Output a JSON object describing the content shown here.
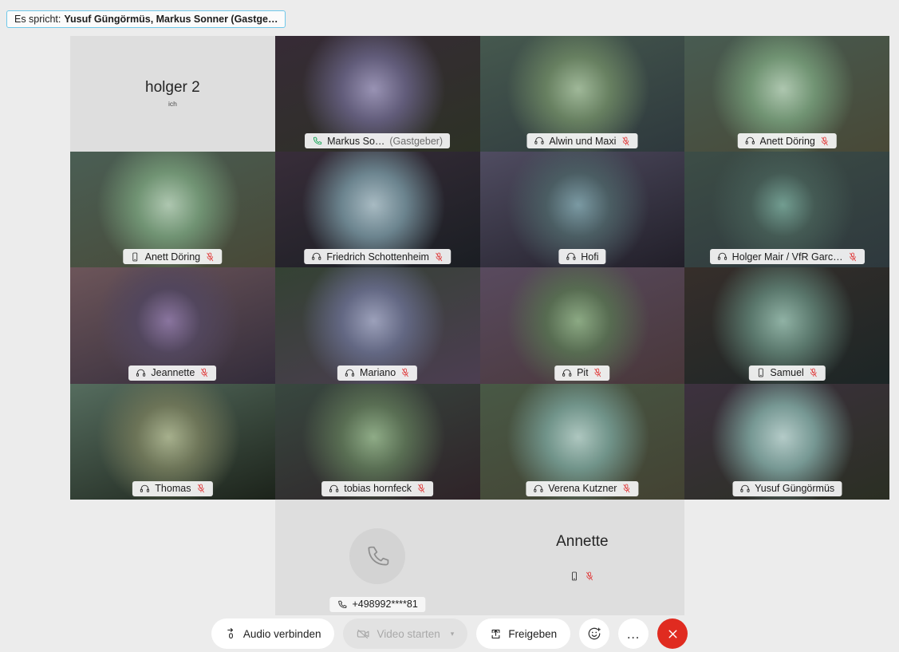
{
  "app": {
    "background_color": "#ececec",
    "active_speaker_color": "#42bdf0",
    "mute_color": "#e03a3a",
    "leave_color": "#e02b20"
  },
  "speaker_banner": {
    "name": "speaker-banner",
    "prefix": "Es spricht:",
    "names": "Yusuf Güngörmüs, Markus Sonner (Gastge…"
  },
  "grid": {
    "columns": 4,
    "rows": 5,
    "tiles": [
      {
        "id": "holger-2",
        "kind": "placeholder",
        "name": "holger 2",
        "sub": "ich",
        "icons": [],
        "active": false,
        "badge": false
      },
      {
        "id": "markus-sonner",
        "kind": "video",
        "name": "Markus So…",
        "host_suffix": "(Gastgeber)",
        "icons": [
          "phone-green"
        ],
        "muted": false,
        "active": true,
        "badge": true
      },
      {
        "id": "alwin-und-maxi",
        "kind": "video",
        "name": "Alwin und Maxi",
        "icons": [
          "headset"
        ],
        "muted": true,
        "active": false,
        "badge": true
      },
      {
        "id": "anett-doring-1",
        "kind": "video",
        "name": "Anett Döring",
        "icons": [
          "headset"
        ],
        "muted": true,
        "active": false,
        "badge": true
      },
      {
        "id": "anett-doring-2",
        "kind": "video",
        "name": "Anett Döring",
        "icons": [
          "mobile"
        ],
        "muted": true,
        "active": false,
        "badge": true
      },
      {
        "id": "friedrich-schottenheim",
        "kind": "video",
        "name": "Friedrich Schottenheim",
        "icons": [
          "headset"
        ],
        "muted": true,
        "active": false,
        "badge": true
      },
      {
        "id": "hofi",
        "kind": "video",
        "name": "Hofi",
        "icons": [
          "headset"
        ],
        "muted": false,
        "active": false,
        "badge": true
      },
      {
        "id": "holger-mair",
        "kind": "video",
        "name": "Holger Mair / VfR Garc…",
        "icons": [
          "headset"
        ],
        "muted": true,
        "active": false,
        "badge": true
      },
      {
        "id": "jeannette",
        "kind": "video",
        "name": "Jeannette",
        "icons": [
          "headset"
        ],
        "muted": true,
        "active": false,
        "badge": true
      },
      {
        "id": "mariano",
        "kind": "video",
        "name": "Mariano",
        "icons": [
          "headset"
        ],
        "muted": true,
        "active": false,
        "badge": true
      },
      {
        "id": "pit",
        "kind": "video",
        "name": "Pit",
        "icons": [
          "headset"
        ],
        "muted": true,
        "active": false,
        "badge": true
      },
      {
        "id": "samuel",
        "kind": "video",
        "name": "Samuel",
        "icons": [
          "mobile"
        ],
        "muted": true,
        "active": false,
        "badge": true
      },
      {
        "id": "thomas",
        "kind": "video",
        "name": "Thomas",
        "icons": [
          "headset"
        ],
        "muted": true,
        "active": false,
        "badge": true
      },
      {
        "id": "tobias-hornfeck",
        "kind": "video",
        "name": "tobias hornfeck",
        "icons": [
          "headset"
        ],
        "muted": true,
        "active": false,
        "badge": true
      },
      {
        "id": "verena-kutzner",
        "kind": "video",
        "name": "Verena Kutzner",
        "icons": [
          "headset"
        ],
        "muted": true,
        "active": false,
        "badge": true
      },
      {
        "id": "yusuf-gungormus",
        "kind": "video",
        "name": "Yusuf Güngörmüs",
        "icons": [
          "headset"
        ],
        "muted": false,
        "active": true,
        "badge": true
      },
      {
        "id": "empty-left",
        "kind": "empty"
      },
      {
        "id": "phone-caller",
        "kind": "phone",
        "name": "+498992****81",
        "icons": [
          "phone"
        ],
        "muted": false,
        "active": false,
        "badge": true
      },
      {
        "id": "annette",
        "kind": "placeholder",
        "name": "Annette",
        "sub": "",
        "icons": [
          "mobile",
          "mic-muted"
        ],
        "active": false,
        "badge": false
      },
      {
        "id": "empty-right",
        "kind": "empty"
      }
    ]
  },
  "toolbar": {
    "audio_label": "Audio verbinden",
    "video_label": "Video starten",
    "share_label": "Freigeben",
    "reactions_label": "",
    "more_label": "…",
    "leave_label": "",
    "icons": {
      "audio": "connect-audio-icon",
      "video": "video-off-icon",
      "share": "share-screen-icon",
      "reactions": "smiley-icon",
      "more": "more-options-icon",
      "leave": "end-call-icon"
    }
  }
}
